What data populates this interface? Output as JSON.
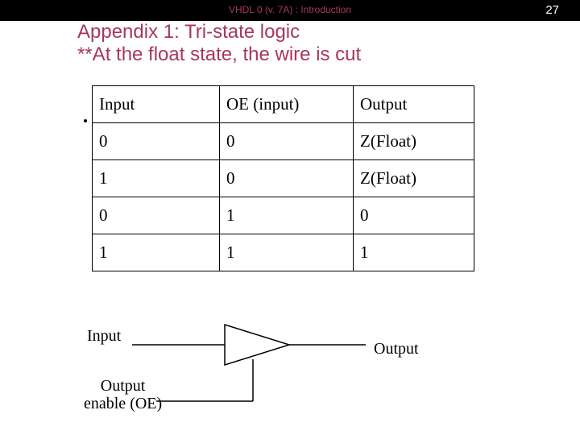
{
  "header": {
    "title": "VHDL 0 (v. 7A) : Introduction",
    "page": "27"
  },
  "slide": {
    "title_line1": "Appendix 1: Tri-state logic",
    "title_line2": "**At the float state, the wire is cut"
  },
  "table": {
    "headers": [
      "Input",
      "OE (input)",
      "Output"
    ],
    "rows": [
      [
        "0",
        "0",
        "Z(Float)"
      ],
      [
        "1",
        "0",
        "Z(Float)"
      ],
      [
        "0",
        "1",
        "0"
      ],
      [
        "1",
        "1",
        "1"
      ]
    ]
  },
  "diagram": {
    "input_label": "Input",
    "output_label": "Output",
    "oe_label_line1": "Output",
    "oe_label_line2": "enable (OE)"
  }
}
